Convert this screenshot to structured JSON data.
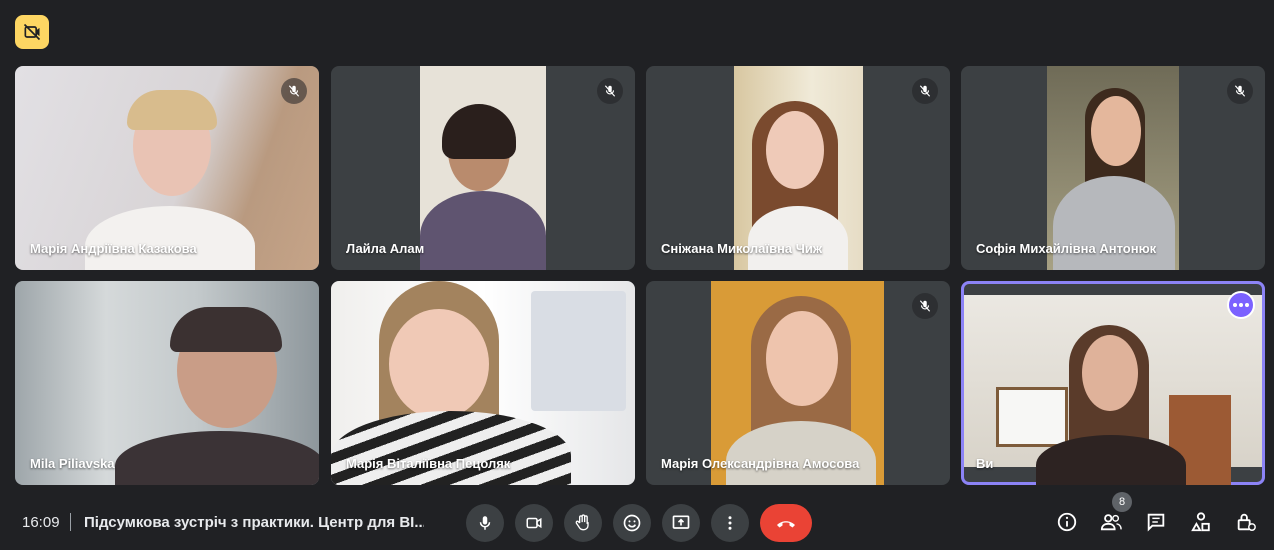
{
  "top_badge": {
    "icon": "no-video-badge-icon",
    "color": "#fdd663"
  },
  "participants": [
    {
      "name": "Марія Андріївна Казакова",
      "muted": true,
      "bg": "#d9d5d0"
    },
    {
      "name": "Лайла Алам",
      "muted": true,
      "bg": "#ddd7cd"
    },
    {
      "name": "Сніжана Миколаївна Чиж",
      "muted": true,
      "bg": "#e8e0cc"
    },
    {
      "name": "Софія Михайлівна Антонюк",
      "muted": true,
      "bg": "#8d8a74"
    },
    {
      "name": "Mila Piliavska",
      "muted": false,
      "bg": "#bfc3c2"
    },
    {
      "name": "Марія Віталіївна Пецоляк",
      "muted": true,
      "bg": "#e6e6e6"
    },
    {
      "name": "Марія Олександрівна Амосова",
      "muted": true,
      "bg": "#d99b37"
    },
    {
      "name": "Ви",
      "muted": false,
      "active": true,
      "bg": "#dfdcd6"
    }
  ],
  "bottom": {
    "time": "16:09",
    "meeting_title": "Підсумкова зустріч з практики. Центр для ВІ...",
    "participants_count": "8",
    "accent_end_call": "#ea4335",
    "active_outline": "#8c83f6"
  }
}
